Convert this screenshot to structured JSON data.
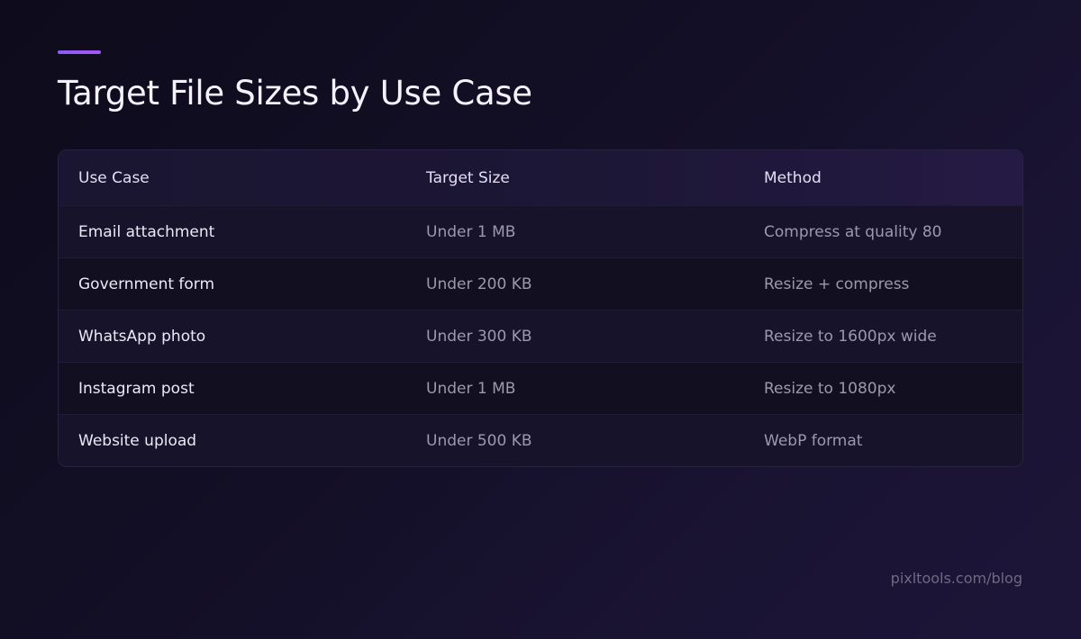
{
  "title": "Target File Sizes by Use Case",
  "table": {
    "headers": [
      "Use Case",
      "Target Size",
      "Method"
    ],
    "rows": [
      [
        "Email attachment",
        "Under 1 MB",
        "Compress at quality 80"
      ],
      [
        "Government form",
        "Under 200 KB",
        "Resize + compress"
      ],
      [
        "WhatsApp photo",
        "Under 300 KB",
        "Resize to 1600px wide"
      ],
      [
        "Instagram post",
        "Under 1 MB",
        "Resize to 1080px"
      ],
      [
        "Website upload",
        "Under 500 KB",
        "WebP format"
      ]
    ]
  },
  "footer": {
    "url": "pixltools.com/blog"
  },
  "colors": {
    "accent": "#8b5cf6",
    "background": "#130f26"
  }
}
